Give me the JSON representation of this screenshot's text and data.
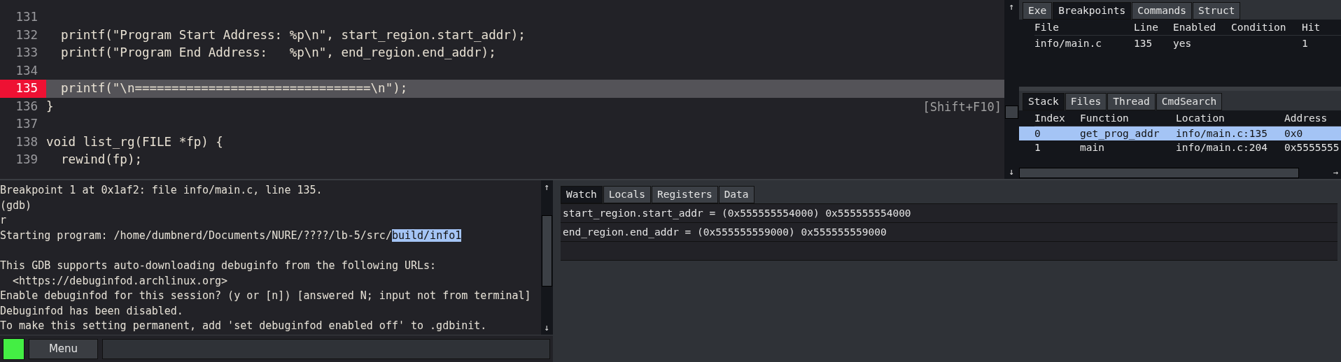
{
  "editor": {
    "lines": [
      {
        "number": "131",
        "current": false
      },
      {
        "number": "132",
        "text": "  printf(\"Program Start Address: %p\\n\", start_region.start_addr);",
        "current": false
      },
      {
        "number": "133",
        "text": "  printf(\"Program End Address:   %p\\n\", end_region.end_addr);",
        "current": false
      },
      {
        "number": "134",
        "current": false
      },
      {
        "number": "135",
        "text": "  printf(\"\\n================================\\n\");",
        "current": true
      },
      {
        "number": "136",
        "text": "}",
        "current": false
      },
      {
        "number": "137",
        "current": false
      },
      {
        "number": "138",
        "text": "void list_rg(FILE *fp) {",
        "current": false
      },
      {
        "number": "139",
        "text": "  rewind(fp);",
        "current": false
      }
    ],
    "hint": "[Shift+F10]",
    "scroll_up": "↑",
    "scroll_down": "↓"
  },
  "breakpoints_panel": {
    "tabs": [
      {
        "label": "Exe",
        "selected": false
      },
      {
        "label": "Breakpoints",
        "selected": true
      },
      {
        "label": "Commands",
        "selected": false
      },
      {
        "label": "Struct",
        "selected": false
      }
    ],
    "columns": [
      "File",
      "Line",
      "Enabled",
      "Condition",
      "Hit"
    ],
    "rows": [
      [
        "info/main.c",
        "135",
        "yes",
        "",
        "1"
      ]
    ]
  },
  "stack_panel": {
    "tabs": [
      {
        "label": "Stack",
        "selected": true
      },
      {
        "label": "Files",
        "selected": false
      },
      {
        "label": "Thread",
        "selected": false
      },
      {
        "label": "CmdSearch",
        "selected": false
      }
    ],
    "columns": [
      "Index",
      "Function",
      "Location",
      "Address"
    ],
    "rows": [
      {
        "cells": [
          "0",
          "get_prog_addr",
          "info/main.c:135",
          "0x0"
        ],
        "selected": true
      },
      {
        "cells": [
          "1",
          "main",
          "info/main.c:204",
          "0x5555555"
        ],
        "selected": false
      }
    ],
    "scroll_right": "→"
  },
  "console": {
    "lines": [
      [
        {
          "text": "Breakpoint 1 at 0x1af2: file info/main.c, line 135.",
          "selected": false
        }
      ],
      [
        {
          "text": "(gdb)",
          "selected": false
        }
      ],
      [
        {
          "text": "r",
          "selected": false
        }
      ],
      [
        {
          "text": "Starting program: /home/dumbnerd/Documents/NURE/????/lb-5/src/",
          "selected": false
        },
        {
          "text": "build/info1",
          "selected": true
        }
      ],
      [
        {
          "text": "This GDB supports auto-downloading debuginfo from the following URLs:",
          "selected": false
        }
      ],
      [
        {
          "text": "  <https://debuginfod.archlinux.org>",
          "selected": false
        }
      ],
      [
        {
          "text": "Enable debuginfod for this session? (y or [n]) [answered N; input not from terminal]",
          "selected": false
        }
      ],
      [
        {
          "text": "Debuginfod has been disabled.",
          "selected": false
        }
      ],
      [
        {
          "text": "To make this setting permanent, add 'set debuginfod enabled off' to .gdbinit.",
          "selected": false
        }
      ]
    ],
    "scroll_up": "↑",
    "scroll_down": "↓"
  },
  "bottom_bar": {
    "busy": false,
    "menu_button": "Menu"
  },
  "watch_panel": {
    "tabs": [
      {
        "label": "Watch",
        "selected": true
      },
      {
        "label": "Locals",
        "selected": false
      },
      {
        "label": "Registers",
        "selected": false
      },
      {
        "label": "Data",
        "selected": false
      }
    ],
    "rows": [
      "start_region.start_addr = (0x555555554000) 0x555555554000",
      "end_region.end_addr = (0x555555559000) 0x555555559000",
      ""
    ]
  }
}
